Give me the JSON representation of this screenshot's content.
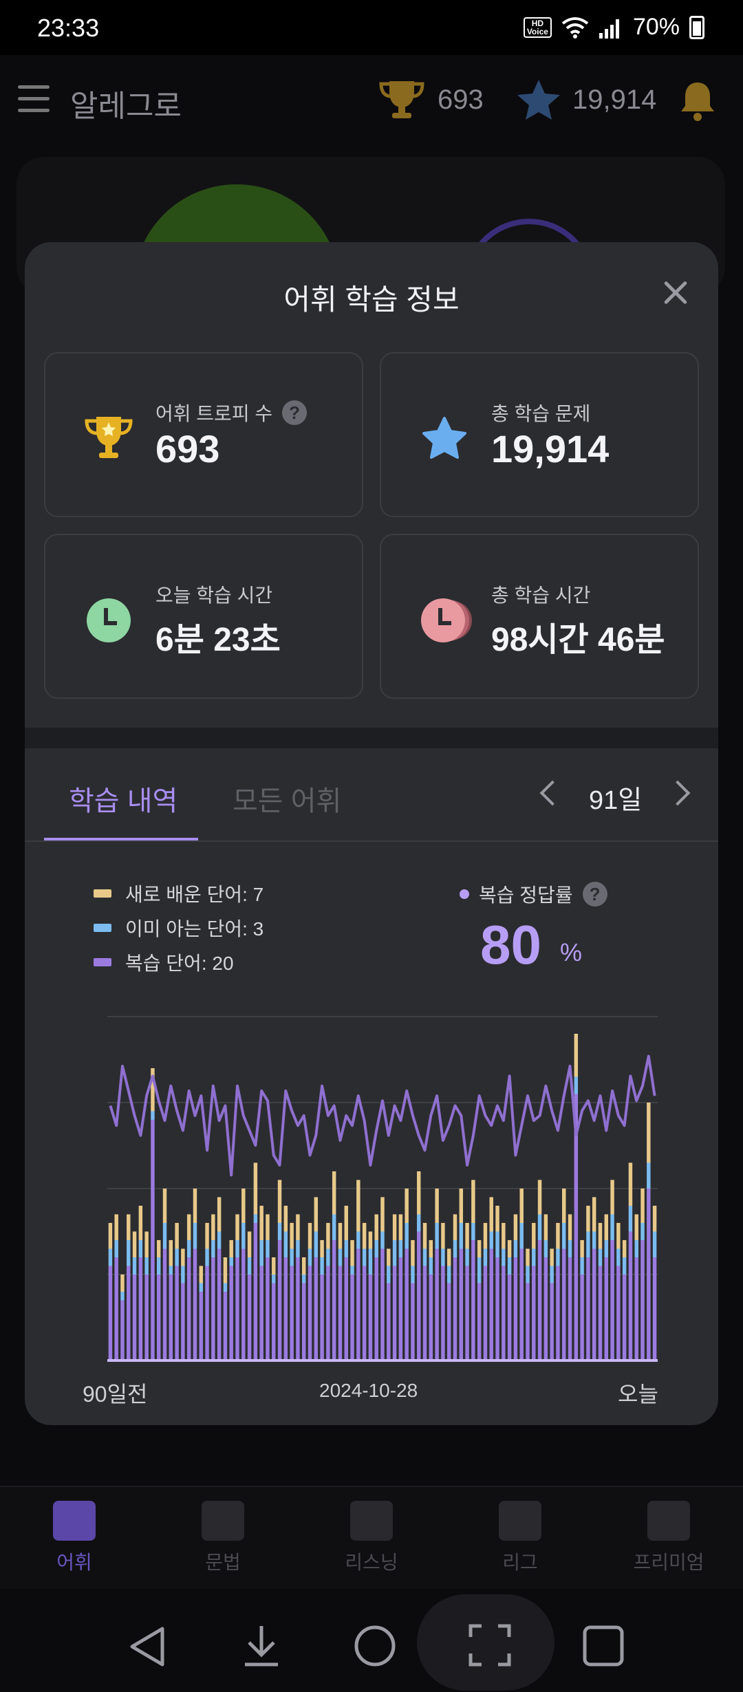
{
  "status_bar": {
    "time": "23:33",
    "hd_label": "HD\nVoice",
    "battery": "70%"
  },
  "app_header": {
    "title": "알레그로",
    "trophies": "693",
    "stars": "19,914"
  },
  "modal": {
    "title": "어휘 학습 정보",
    "cards": [
      {
        "label": "어휘 트로피 수",
        "value": "693",
        "help": "?"
      },
      {
        "label": "총 학습 문제",
        "value": "19,914"
      },
      {
        "label": "오늘 학습 시간",
        "value": "6분 23초"
      },
      {
        "label": "총 학습 시간",
        "value": "98시간 46분"
      }
    ],
    "tabs": [
      {
        "label": "학습 내역"
      },
      {
        "label": "모든 어휘"
      }
    ],
    "range": "91일",
    "legend": [
      {
        "label": "새로 배운 단어: 7",
        "color": "#e8c98a"
      },
      {
        "label": "이미 아는 단어: 3",
        "color": "#7cbcf0"
      },
      {
        "label": "복습 단어: 20",
        "color": "#9b7be0"
      }
    ],
    "accuracy": {
      "label": "복습 정답률",
      "value": "80",
      "unit": "%",
      "help": "?"
    },
    "axis": {
      "start": "90일전",
      "mid": "2024-10-28",
      "end": "오늘"
    }
  },
  "chart_data": {
    "type": "bar",
    "stacked": true,
    "colors": {
      "new": "#e8c98a",
      "known": "#7cbcf0",
      "review": "#9b7be0",
      "accuracy_line": "#8f70d0"
    },
    "ylim": [
      0,
      40
    ],
    "series": [
      {
        "name": "새로 배운 단어",
        "values": [
          3,
          3,
          2,
          3,
          3,
          4,
          3,
          5,
          2,
          4,
          3,
          3,
          2,
          3,
          4,
          2,
          3,
          3,
          4,
          3,
          2,
          3,
          4,
          3,
          6,
          4,
          3,
          2,
          5,
          3,
          3,
          3,
          2,
          3,
          4,
          2,
          3,
          5,
          3,
          4,
          3,
          6,
          3,
          2,
          3,
          4,
          2,
          3,
          3,
          4,
          3,
          5,
          3,
          2,
          4,
          3,
          2,
          3,
          4,
          3,
          5,
          2,
          3,
          4,
          3,
          3,
          2,
          3,
          4,
          2,
          3,
          4,
          3,
          2,
          3,
          4,
          3,
          5,
          2,
          3,
          4,
          3,
          3,
          4,
          3,
          2,
          5,
          3,
          4,
          7,
          3
        ]
      },
      {
        "name": "이미 아는 단어",
        "values": [
          2,
          2,
          1,
          3,
          2,
          2,
          2,
          1,
          2,
          3,
          1,
          2,
          2,
          2,
          3,
          1,
          2,
          2,
          2,
          1,
          1,
          2,
          3,
          2,
          1,
          3,
          2,
          1,
          2,
          3,
          2,
          2,
          1,
          2,
          3,
          2,
          2,
          3,
          2,
          2,
          1,
          2,
          2,
          3,
          2,
          2,
          2,
          3,
          2,
          3,
          2,
          2,
          2,
          2,
          3,
          2,
          2,
          2,
          3,
          2,
          2,
          3,
          2,
          2,
          3,
          2,
          2,
          2,
          3,
          2,
          2,
          3,
          2,
          2,
          2,
          3,
          2,
          2,
          2,
          3,
          2,
          2,
          2,
          3,
          2,
          2,
          3,
          2,
          2,
          3,
          3
        ]
      },
      {
        "name": "복습 단어",
        "values": [
          11,
          12,
          7,
          11,
          10,
          12,
          10,
          28,
          10,
          13,
          10,
          11,
          9,
          12,
          13,
          8,
          11,
          12,
          13,
          8,
          11,
          12,
          13,
          10,
          16,
          11,
          12,
          9,
          14,
          12,
          11,
          12,
          9,
          11,
          12,
          10,
          11,
          14,
          11,
          12,
          10,
          13,
          11,
          10,
          12,
          13,
          9,
          11,
          12,
          13,
          9,
          15,
          11,
          10,
          13,
          11,
          9,
          12,
          13,
          11,
          14,
          9,
          11,
          13,
          12,
          11,
          10,
          12,
          13,
          9,
          11,
          14,
          12,
          9,
          11,
          13,
          12,
          31,
          10,
          12,
          13,
          11,
          12,
          14,
          11,
          10,
          15,
          12,
          14,
          20,
          12
        ]
      },
      {
        "name": "복습 정답률",
        "values": [
          82,
          78,
          90,
          85,
          80,
          76,
          84,
          88,
          83,
          79,
          86,
          81,
          77,
          85,
          80,
          84,
          73,
          86,
          79,
          82,
          68,
          86,
          80,
          77,
          74,
          85,
          83,
          72,
          70,
          85,
          81,
          78,
          80,
          72,
          76,
          86,
          80,
          82,
          75,
          80,
          78,
          84,
          79,
          70,
          77,
          83,
          76,
          82,
          79,
          85,
          80,
          76,
          73,
          80,
          84,
          75,
          78,
          82,
          80,
          70,
          76,
          84,
          80,
          78,
          82,
          79,
          88,
          72,
          78,
          84,
          79,
          80,
          86,
          81,
          77,
          84,
          90,
          76,
          81,
          83,
          79,
          84,
          77,
          85,
          80,
          78,
          88,
          83,
          86,
          92,
          84
        ]
      }
    ]
  }
}
